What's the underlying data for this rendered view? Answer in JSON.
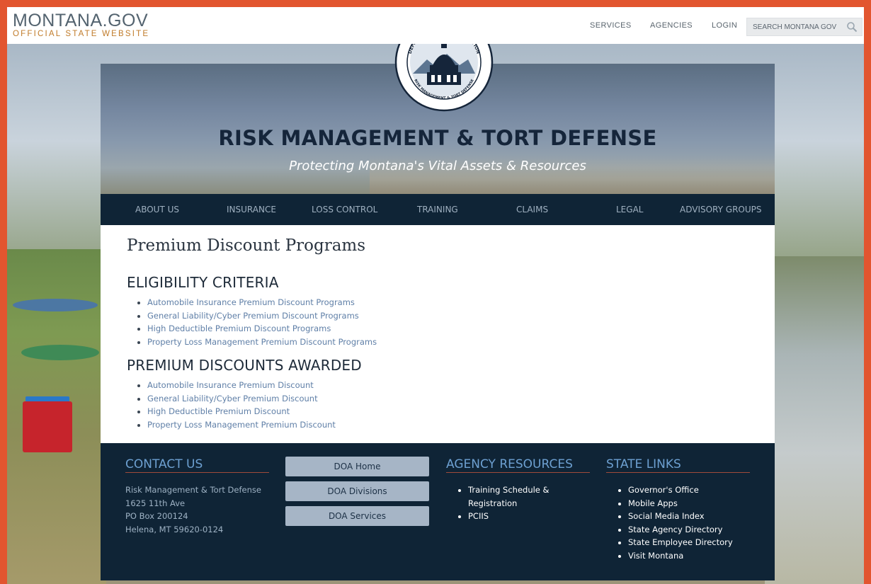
{
  "header": {
    "brand_name": "MONTANA.GOV",
    "brand_sub": "OFFICIAL STATE WEBSITE",
    "nav": [
      "SERVICES",
      "AGENCIES",
      "LOGIN"
    ],
    "search_placeholder": "SEARCH MONTANA GOV"
  },
  "logo": {
    "top_text": "DEPARTMENT OF ADMINISTRATION",
    "left_text": "MONTANA",
    "bottom_text": "RISK MANAGEMENT & TORT DEFENSE"
  },
  "banner": {
    "title": "RISK MANAGEMENT & TORT DEFENSE",
    "tagline": "Protecting Montana's Vital Assets & Resources"
  },
  "main_nav": [
    "ABOUT US",
    "INSURANCE",
    "LOSS CONTROL",
    "TRAINING",
    "CLAIMS",
    "LEGAL",
    "ADVISORY GROUPS"
  ],
  "content": {
    "page_title": "Premium Discount Programs",
    "section1": {
      "heading": "ELIGIBILITY CRITERIA",
      "items": [
        "Automobile Insurance Premium Discount Programs",
        "General Liability/Cyber Premium Discount Programs",
        "High Deductible Premium Discount Programs",
        "Property Loss Management Premium Discount Programs"
      ]
    },
    "section2": {
      "heading": "PREMIUM DISCOUNTS AWARDED",
      "items": [
        "Automobile Insurance Premium Discount",
        "General Liability/Cyber Premium Discount",
        "High Deductible Premium Discount",
        "Property Loss Management Premium Discount"
      ]
    }
  },
  "footer": {
    "contact": {
      "heading": "CONTACT US",
      "lines": [
        "Risk Management & Tort Defense",
        "1625 11th Ave",
        "PO Box 200124",
        "Helena, MT 59620-0124"
      ]
    },
    "buttons": [
      "DOA Home",
      "DOA Divisions",
      "DOA Services"
    ],
    "agency_resources": {
      "heading": "AGENCY RESOURCES",
      "items": [
        "Training Schedule & Registration",
        "PCIIS"
      ]
    },
    "state_links": {
      "heading": "STATE LINKS",
      "items": [
        "Governor's Office",
        "Mobile Apps",
        "Social Media Index",
        "State Agency Directory",
        "State Employee Directory",
        "Visit Montana"
      ]
    }
  },
  "colors": {
    "page_border": "#e2552f",
    "nav_bg": "#0f2436",
    "link": "#5f7fa7",
    "footer_heading": "#6da0d1",
    "button_bg": "#a6b5c6"
  }
}
